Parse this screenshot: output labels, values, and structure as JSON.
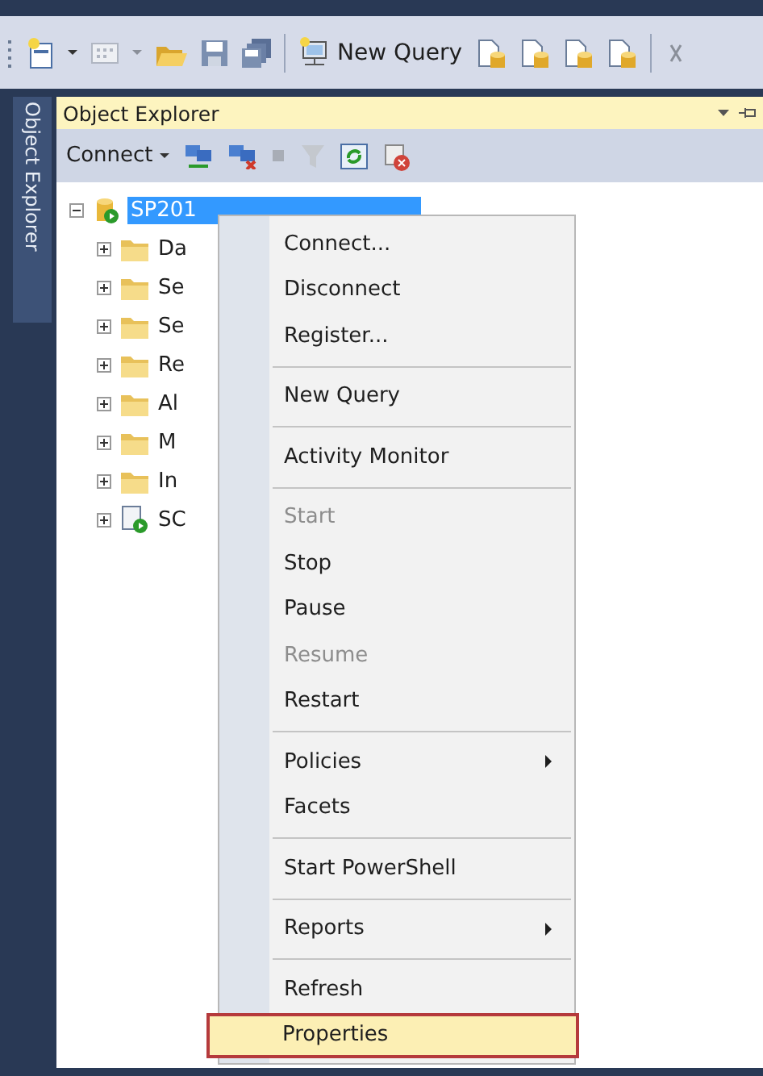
{
  "toolbar": {
    "new_query_label": "New Query"
  },
  "side_tab": {
    "label": "Object Explorer"
  },
  "panel": {
    "title": "Object Explorer",
    "connect_label": "Connect"
  },
  "tree": {
    "root": {
      "label": "SP201",
      "selected": true,
      "expanded": true,
      "children": [
        {
          "label": "Da",
          "kind": "folder",
          "expanded": false
        },
        {
          "label": "Se",
          "kind": "folder",
          "expanded": false
        },
        {
          "label": "Se",
          "kind": "folder",
          "expanded": false
        },
        {
          "label": "Re",
          "kind": "folder",
          "expanded": false
        },
        {
          "label": "Al",
          "kind": "folder",
          "expanded": false
        },
        {
          "label": "M",
          "kind": "folder",
          "expanded": false
        },
        {
          "label": "In",
          "kind": "folder",
          "expanded": false
        },
        {
          "label": "SC",
          "kind": "agent",
          "expanded": false
        }
      ]
    }
  },
  "context_menu": {
    "items": [
      {
        "kind": "item",
        "label": "Connect...",
        "disabled": false,
        "submenu": false,
        "selected": false
      },
      {
        "kind": "item",
        "label": "Disconnect",
        "disabled": false,
        "submenu": false,
        "selected": false
      },
      {
        "kind": "item",
        "label": "Register...",
        "disabled": false,
        "submenu": false,
        "selected": false
      },
      {
        "kind": "separator"
      },
      {
        "kind": "item",
        "label": "New Query",
        "disabled": false,
        "submenu": false,
        "selected": false
      },
      {
        "kind": "separator"
      },
      {
        "kind": "item",
        "label": "Activity Monitor",
        "disabled": false,
        "submenu": false,
        "selected": false
      },
      {
        "kind": "separator"
      },
      {
        "kind": "item",
        "label": "Start",
        "disabled": true,
        "submenu": false,
        "selected": false
      },
      {
        "kind": "item",
        "label": "Stop",
        "disabled": false,
        "submenu": false,
        "selected": false
      },
      {
        "kind": "item",
        "label": "Pause",
        "disabled": false,
        "submenu": false,
        "selected": false
      },
      {
        "kind": "item",
        "label": "Resume",
        "disabled": true,
        "submenu": false,
        "selected": false
      },
      {
        "kind": "item",
        "label": "Restart",
        "disabled": false,
        "submenu": false,
        "selected": false
      },
      {
        "kind": "separator"
      },
      {
        "kind": "item",
        "label": "Policies",
        "disabled": false,
        "submenu": true,
        "selected": false
      },
      {
        "kind": "item",
        "label": "Facets",
        "disabled": false,
        "submenu": false,
        "selected": false
      },
      {
        "kind": "separator"
      },
      {
        "kind": "item",
        "label": "Start PowerShell",
        "disabled": false,
        "submenu": false,
        "selected": false
      },
      {
        "kind": "separator"
      },
      {
        "kind": "item",
        "label": "Reports",
        "disabled": false,
        "submenu": true,
        "selected": false
      },
      {
        "kind": "separator"
      },
      {
        "kind": "item",
        "label": "Refresh",
        "disabled": false,
        "submenu": false,
        "selected": false
      },
      {
        "kind": "item",
        "label": "Properties",
        "disabled": false,
        "submenu": false,
        "selected": true
      }
    ]
  }
}
